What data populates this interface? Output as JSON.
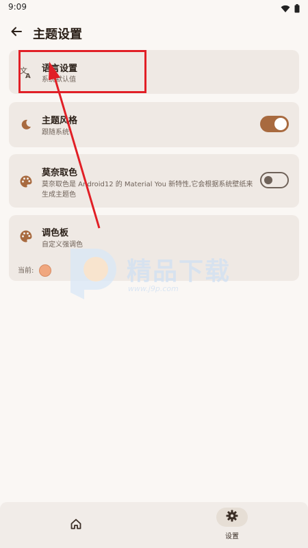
{
  "status_bar": {
    "time": "9:09",
    "wifi_icon": "wifi-icon",
    "battery_icon": "battery-icon"
  },
  "app_bar": {
    "title": "主题设置",
    "back_icon": "arrow-left-icon"
  },
  "settings": {
    "language": {
      "title": "语言设置",
      "subtitle": "系统默认值",
      "icon": "translate-icon"
    },
    "theme_style": {
      "title": "主题风格",
      "subtitle": "跟随系统",
      "icon": "moon-icon",
      "toggle_on": true
    },
    "monet": {
      "title": "莫奈取色",
      "subtitle": "莫奈取色是 Android12 的 Material You 新特性,它会根据系统壁纸来生成主题色",
      "icon": "palette-icon",
      "toggle_on": false
    },
    "palette": {
      "title": "调色板",
      "subtitle": "自定义强调色",
      "icon": "palette-icon",
      "current_label": "当前:",
      "current_color": "#f0a77f"
    }
  },
  "watermark": {
    "text": "精品下载",
    "url": "www.j9p.com"
  },
  "bottom_nav": {
    "home_icon": "home-icon",
    "settings_icon": "gear-icon",
    "settings_label": "设置"
  },
  "colors": {
    "accent": "#a86a3f",
    "annotation": "#e11f26",
    "card_bg": "#efe9e4"
  }
}
